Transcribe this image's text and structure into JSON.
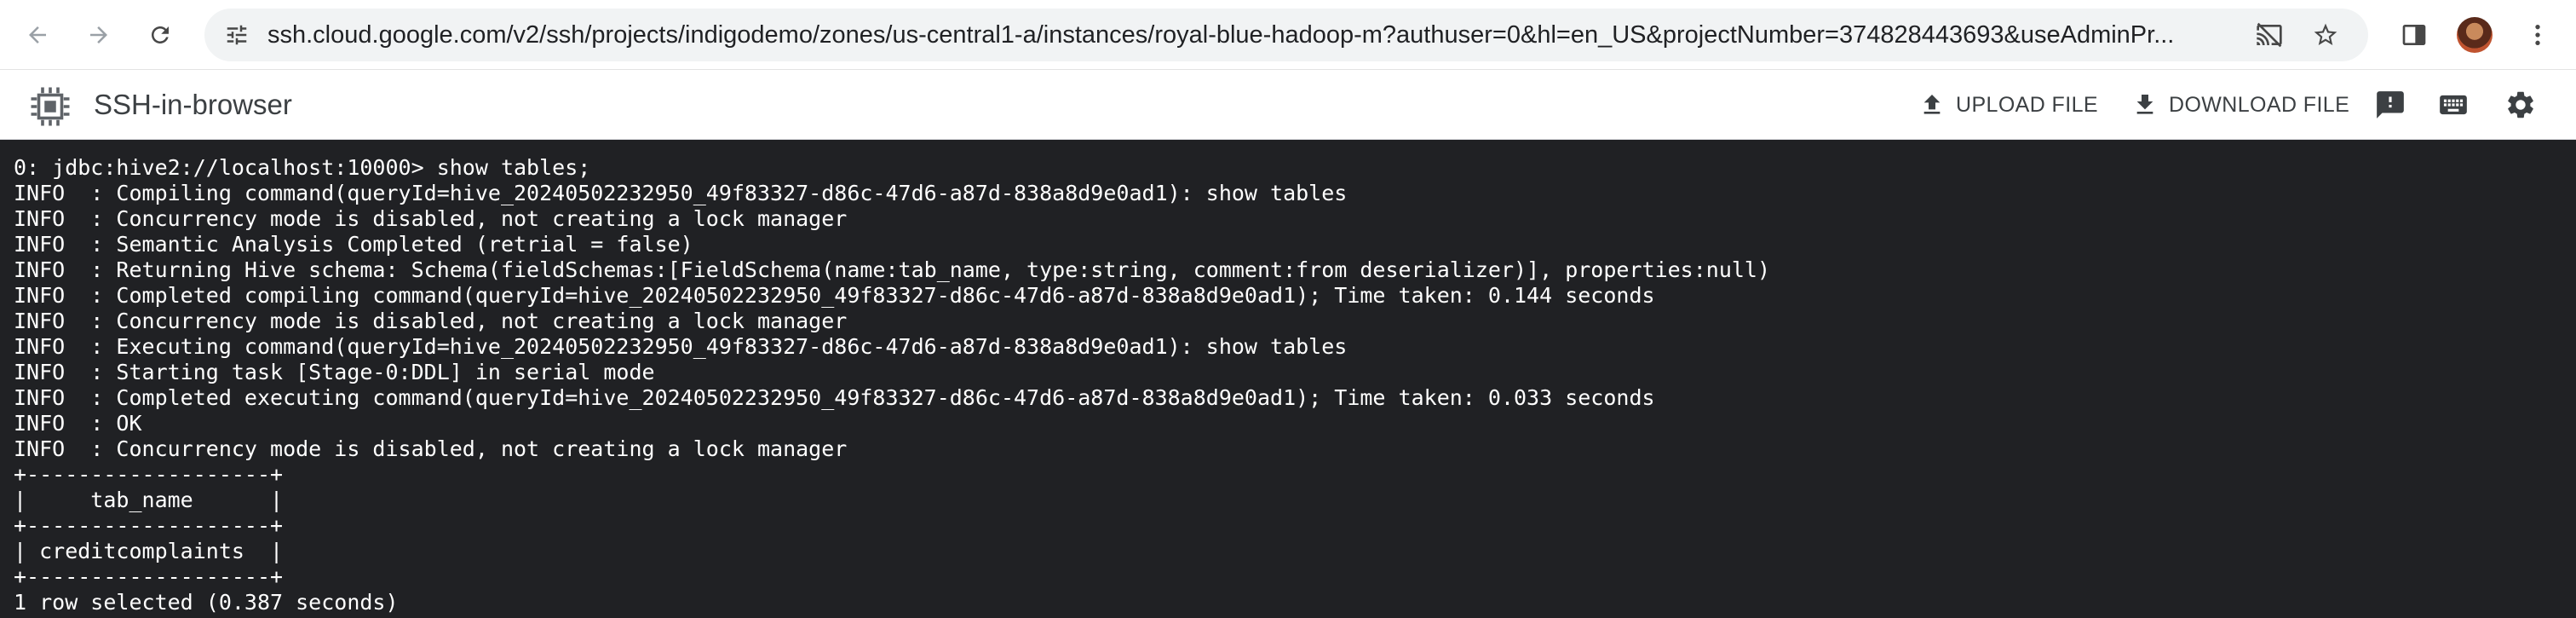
{
  "browser": {
    "url": "ssh.cloud.google.com/v2/ssh/projects/indigodemo/zones/us-central1-a/instances/royal-blue-hadoop-m?authuser=0&hl=en_US&projectNumber=374828443693&useAdminPr..."
  },
  "app": {
    "title": "SSH-in-browser",
    "upload_label": "UPLOAD FILE",
    "download_label": "DOWNLOAD FILE"
  },
  "terminal": {
    "lines": [
      "0: jdbc:hive2://localhost:10000> show tables;",
      "INFO  : Compiling command(queryId=hive_20240502232950_49f83327-d86c-47d6-a87d-838a8d9e0ad1): show tables",
      "INFO  : Concurrency mode is disabled, not creating a lock manager",
      "INFO  : Semantic Analysis Completed (retrial = false)",
      "INFO  : Returning Hive schema: Schema(fieldSchemas:[FieldSchema(name:tab_name, type:string, comment:from deserializer)], properties:null)",
      "INFO  : Completed compiling command(queryId=hive_20240502232950_49f83327-d86c-47d6-a87d-838a8d9e0ad1); Time taken: 0.144 seconds",
      "INFO  : Concurrency mode is disabled, not creating a lock manager",
      "INFO  : Executing command(queryId=hive_20240502232950_49f83327-d86c-47d6-a87d-838a8d9e0ad1): show tables",
      "INFO  : Starting task [Stage-0:DDL] in serial mode",
      "INFO  : Completed executing command(queryId=hive_20240502232950_49f83327-d86c-47d6-a87d-838a8d9e0ad1); Time taken: 0.033 seconds",
      "INFO  : OK",
      "INFO  : Concurrency mode is disabled, not creating a lock manager",
      "+-------------------+",
      "|     tab_name      |",
      "+-------------------+",
      "| creditcomplaints  |",
      "+-------------------+",
      "1 row selected (0.387 seconds)"
    ]
  },
  "colors": {
    "terminal_bg": "#202124",
    "terminal_fg": "#ffffff",
    "chrome_bg": "#ffffff",
    "omnibox_bg": "#f1f3f4"
  },
  "icons": {
    "back": "arrow-back-icon",
    "forward": "arrow-forward-icon",
    "reload": "reload-icon",
    "site_info": "tune-icon",
    "cast": "cast-off-icon",
    "bookmark": "star-icon",
    "side_panel": "side-panel-icon",
    "menu": "more-vert-icon",
    "upload": "upload-icon",
    "download": "download-icon",
    "feedback": "feedback-icon",
    "keyboard": "keyboard-icon",
    "settings": "gear-icon"
  }
}
